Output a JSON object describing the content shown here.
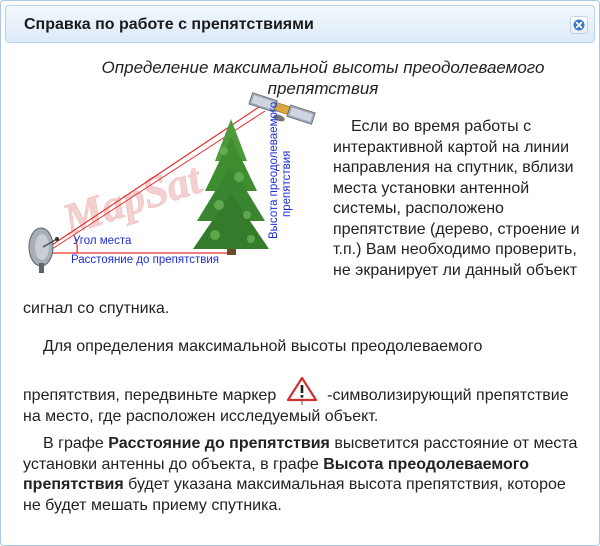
{
  "window": {
    "title": "Справка по работе с препятствиями",
    "close_icon": "close-icon"
  },
  "content": {
    "subtitle_line1": "Определение максимальной высоты преодолеваемого",
    "subtitle_line2": "препятствия",
    "illustration": {
      "angle_label": "Угол места",
      "distance_label": "Расстояние до препятствия",
      "height_label_line1": "Высота преодолеваемого",
      "height_label_line2": "препятствия",
      "watermark": "MapSat",
      "icons": [
        "satellite-icon",
        "tree-icon",
        "dish-antenna-icon"
      ],
      "colors": {
        "sight_line": "#e53030",
        "label_text": "#1a2fd6",
        "tree": "#3d8a2e"
      }
    },
    "paragraph1_right": "Если во время работы с интерактивной картой на линии направления на спутник, вблизи места установки антенной системы, расположено препятствие (дерево, строение и т.п.) Вам необходимо проверить, не экранирует ли данный объект",
    "paragraph1_bottom": "сигнал со спутника.",
    "paragraph2": "Для определения максимальной высоты преодолеваемого",
    "paragraph3_a": "препятствия, передвиньте маркер",
    "paragraph3_b": "-символизирующий препятствие на место, где расположен исследуемый объект.",
    "marker_icon": "warning-marker-icon",
    "paragraph4": {
      "t1": "В графе ",
      "b1": "Расстояние до препятствия",
      "t2": " высветится расстояние от места установки антенны до объекта, в графе ",
      "b2": "Высота преодолеваемого препятствия",
      "t3": " будет указана максимальная высота препятствия, которое не будет мешать приему спутника."
    }
  }
}
